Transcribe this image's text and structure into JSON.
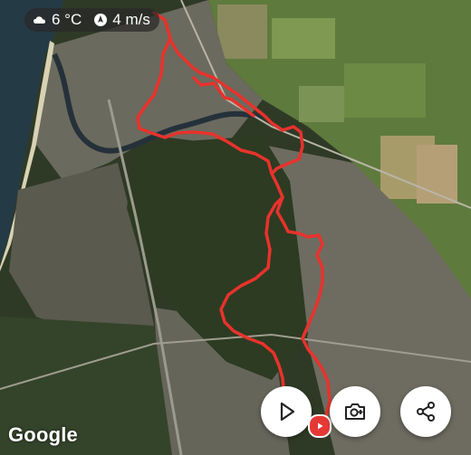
{
  "weather": {
    "temperature": "6 °C",
    "wind": "4 m/s",
    "temperature_icon": "cloud-sun-icon",
    "wind_icon": "wind-direction-icon"
  },
  "map": {
    "provider": "Google",
    "route_color": "#e8322c",
    "marker_color": "#e53935"
  },
  "buttons": {
    "play": "play-icon",
    "screenshot": "camera-plus-icon",
    "share": "share-icon"
  }
}
